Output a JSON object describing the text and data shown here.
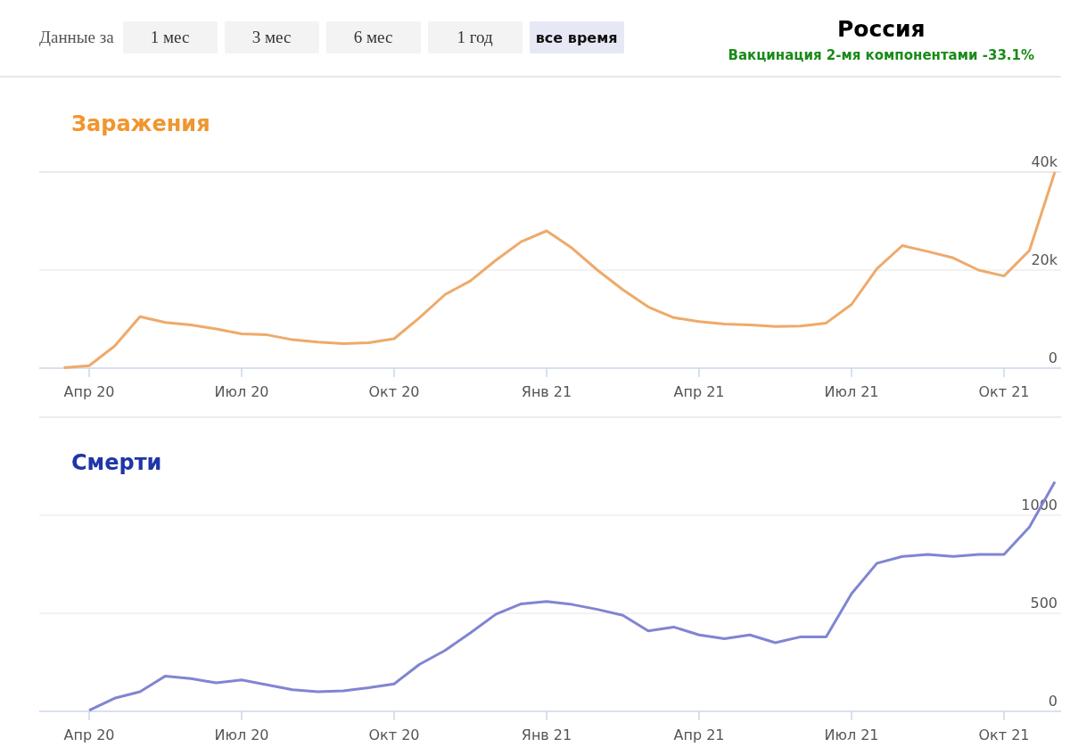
{
  "range_selector": {
    "label": "Данные за",
    "options": [
      {
        "label": "1 мес",
        "selected": false
      },
      {
        "label": "3 мес",
        "selected": false
      },
      {
        "label": "6 мес",
        "selected": false
      },
      {
        "label": "1 год",
        "selected": false
      },
      {
        "label": "все время",
        "selected": true
      }
    ]
  },
  "region": {
    "title": "Россия",
    "vaccination": "Вакцинация 2-мя компонентами -33.1%"
  },
  "charts": [
    {
      "color": "#f0962e",
      "chart_data": {
        "type": "line",
        "title": "Заражения",
        "categories": [
          null,
          "Апр 20",
          null,
          null,
          null,
          null,
          null,
          "Июл 20",
          null,
          null,
          null,
          null,
          null,
          "Окт 20",
          null,
          null,
          null,
          null,
          null,
          "Янв 21",
          null,
          null,
          null,
          null,
          null,
          "Апр 21",
          null,
          null,
          null,
          null,
          null,
          "Июл 21",
          null,
          null,
          null,
          null,
          null,
          "Окт 21",
          null,
          null
        ],
        "ylim": [
          0,
          40
        ],
        "series": [
          {
            "color": "#eeaa6a",
            "values": [
              0.1,
              0.5,
              4.5,
              10.5,
              9.3,
              8.8,
              8.0,
              7,
              6.8,
              5.8,
              5.3,
              5,
              5.2,
              6,
              10.3,
              15,
              17.8,
              22,
              25.8,
              28,
              24.5,
              20,
              16,
              12.5,
              10.3,
              9.5,
              9,
              8.8,
              8.5,
              8.6,
              9.2,
              13,
              20.3,
              25,
              23.8,
              22.5,
              20,
              18.8,
              24,
              40
            ]
          }
        ],
        "yticks": [
          {
            "value": 0,
            "label": "0"
          },
          {
            "value": 20,
            "label": "20k"
          },
          {
            "value": 40,
            "label": "40k"
          }
        ]
      }
    },
    {
      "color": "#1f35a8",
      "chart_data": {
        "type": "line",
        "title": "Смерти",
        "categories": [
          null,
          "Апр 20",
          null,
          null,
          null,
          null,
          null,
          "Июл 20",
          null,
          null,
          null,
          null,
          null,
          "Окт 20",
          null,
          null,
          null,
          null,
          null,
          "Янв 21",
          null,
          null,
          null,
          null,
          null,
          "Апр 21",
          null,
          null,
          null,
          null,
          null,
          "Июл 21",
          null,
          null,
          null,
          null,
          null,
          "Окт 21",
          null,
          null
        ],
        "ylim": [
          0,
          1500
        ],
        "series": [
          {
            "color": "#8085d2",
            "values": [
              null,
              5,
              67,
              100,
              180,
              167,
              145,
              160,
              135,
              110,
              100,
              105,
              120,
              140,
              240,
              310,
              400,
              495,
              548,
              560,
              545,
              520,
              490,
              410,
              430,
              390,
              370,
              390,
              350,
              380,
              380,
              600,
              755,
              790,
              800,
              790,
              800,
              800,
              940,
              1170
            ]
          }
        ],
        "yticks": [
          {
            "value": 0,
            "label": "0"
          },
          {
            "value": 500,
            "label": "500"
          },
          {
            "value": 1000,
            "label": "1000"
          }
        ]
      }
    }
  ]
}
